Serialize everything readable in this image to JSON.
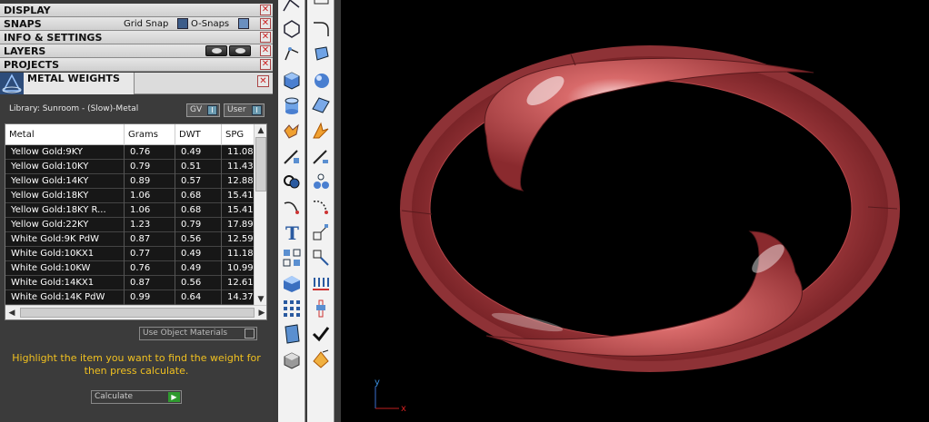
{
  "rollouts": {
    "display": "DISPLAY",
    "snaps": "SNAPS",
    "grid_snap": "Grid Snap",
    "o_snaps": "O-Snaps",
    "info": "INFO & SETTINGS",
    "layers": "LAYERS",
    "projects": "PROJECTS",
    "close_glyph": "✕"
  },
  "metal_weights": {
    "title": "METAL WEIGHTS",
    "library": "Library: Sunroom - (Slow)-Metal",
    "gv_label": "GV",
    "user_label": "User",
    "columns": [
      "Metal",
      "Grams",
      "DWT",
      "SPG"
    ],
    "rows": [
      [
        "Yellow Gold:9KY",
        "0.76",
        "0.49",
        "11.08"
      ],
      [
        "Yellow Gold:10KY",
        "0.79",
        "0.51",
        "11.43"
      ],
      [
        "Yellow Gold:14KY",
        "0.89",
        "0.57",
        "12.88"
      ],
      [
        "Yellow Gold:18KY",
        "1.06",
        "0.68",
        "15.41"
      ],
      [
        "Yellow Gold:18KY R...",
        "1.06",
        "0.68",
        "15.41"
      ],
      [
        "Yellow Gold:22KY",
        "1.23",
        "0.79",
        "17.89"
      ],
      [
        "White Gold:9K PdW",
        "0.87",
        "0.56",
        "12.59"
      ],
      [
        "White Gold:10KX1",
        "0.77",
        "0.49",
        "11.18"
      ],
      [
        "White Gold:10KW",
        "0.76",
        "0.49",
        "10.99"
      ],
      [
        "White Gold:14KX1",
        "0.87",
        "0.56",
        "12.61"
      ],
      [
        "White Gold:14K PdW",
        "0.99",
        "0.64",
        "14.37"
      ]
    ],
    "use_object_materials": "Use Object Materials",
    "hint": "Highlight the item you want to find the weight for then press calculate.",
    "calculate": "Calculate"
  },
  "viewport": {
    "axis_y": "y",
    "axis_x": "x",
    "background": "#000000",
    "model_color": "#b8474a"
  }
}
